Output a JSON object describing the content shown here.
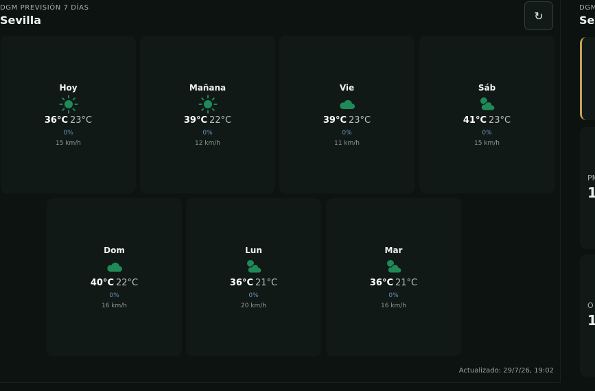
{
  "header": {
    "source": "DGM PREVISIÓN 7 DÍAS",
    "city": "Sevilla",
    "refresh_icon": "↻"
  },
  "forecast": [
    {
      "day": "Hoy",
      "icon": "sun-icon",
      "max": "36°C",
      "min": "23°C",
      "rain": "0%",
      "wind": "15 km/h"
    },
    {
      "day": "Mañana",
      "icon": "sun-icon",
      "max": "39°C",
      "min": "22°C",
      "rain": "0%",
      "wind": "12 km/h"
    },
    {
      "day": "Vie",
      "icon": "cloud-icon",
      "max": "39°C",
      "min": "23°C",
      "rain": "0%",
      "wind": "11 km/h"
    },
    {
      "day": "Sáb",
      "icon": "partly-cloudy-icon",
      "max": "41°C",
      "min": "23°C",
      "rain": "0%",
      "wind": "15 km/h"
    },
    {
      "day": "Dom",
      "icon": "cloud-icon",
      "max": "40°C",
      "min": "22°C",
      "rain": "0%",
      "wind": "16 km/h"
    },
    {
      "day": "Lun",
      "icon": "partly-cloudy-icon",
      "max": "36°C",
      "min": "21°C",
      "rain": "0%",
      "wind": "20 km/h"
    },
    {
      "day": "Mar",
      "icon": "partly-cloudy-icon",
      "max": "36°C",
      "min": "21°C",
      "rain": "0%",
      "wind": "16 km/h"
    }
  ],
  "footer": {
    "updated": "Actualizado: 29/7/26, 19:02"
  },
  "side_panel": {
    "source": "DGM",
    "city": "Sev",
    "card1_label": "PM",
    "card1_value": "1",
    "card2_label": "O",
    "card2_value": "1"
  },
  "colors": {
    "icon_green": "#1f8a57",
    "rain_blue": "#6f93c4",
    "alert_gold": "#c6a356"
  }
}
